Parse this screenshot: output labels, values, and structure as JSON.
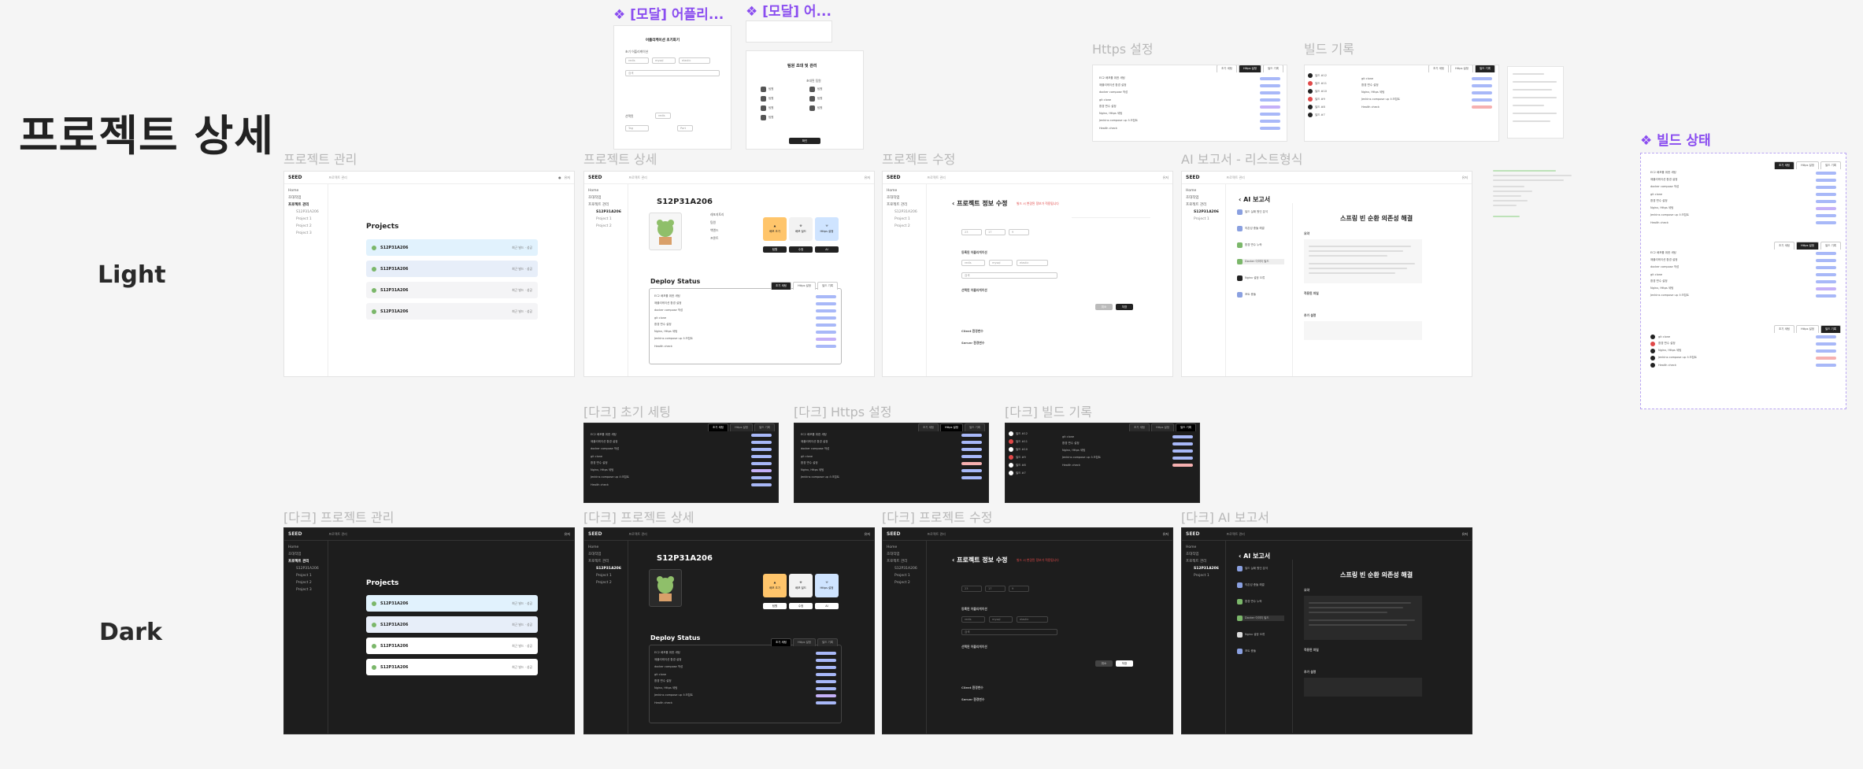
{
  "page": {
    "title": "프로젝트 상세"
  },
  "rows": {
    "light": "Light",
    "dark": "Dark"
  },
  "frame_labels": {
    "proj_manage": "프로젝트 관리",
    "proj_detail": "프로젝트 상세",
    "proj_edit": "프로젝트 수정",
    "ai_report_list": "AI 보고서 - 리스트형식",
    "https_setting": "Https 설정",
    "build_log": "빌드 기록",
    "dark_init": "[다크] 초기 세팅",
    "dark_https": "[다크] Https 설정",
    "dark_build": "[다크] 빌드 기록",
    "dark_proj_manage": "[다크] 프로젝트 관리",
    "dark_proj_detail": "[다크] 프로젝트 상세",
    "dark_proj_edit": "[다크] 프로젝트 수정",
    "dark_ai_report": "[다크] AI 보고서"
  },
  "component_labels": {
    "modal_app": "❖ [모달] 어플리...",
    "modal_2": "❖ [모달] 어...",
    "build_status": "❖ 빌드 상태"
  },
  "modal_app": {
    "title": "어플리케이션 초기화기",
    "label": "초기 어플리케이션"
  },
  "modal_invite": {
    "title": "팀원 초대 및 관리",
    "tab": "초대된 팀원",
    "button": "확인"
  },
  "app": {
    "logo": "SEED",
    "crumb": "프로젝트 관리",
    "user": "유저",
    "sidebar": [
      "Home",
      "초대작업",
      "프로젝트 관리",
      "S12P31A206",
      "Project 1",
      "Project 2",
      "Project 3"
    ]
  },
  "projects": {
    "heading": "Projects",
    "items": [
      {
        "name": "S12P31A206",
        "meta": "최근 빌드 · 성공"
      },
      {
        "name": "S12P31A206",
        "meta": "최근 빌드 · 성공"
      },
      {
        "name": "S12P31A206",
        "meta": "최근 빌드 · 성공"
      },
      {
        "name": "S12P31A206",
        "meta": "최근 빌드 · 성공"
      }
    ]
  },
  "detail": {
    "project_name": "S12P31A206",
    "deploy_status": "Deploy Status",
    "tiles": [
      "배포 초기",
      "배포 빌드",
      "Https 설정"
    ],
    "tabs": [
      "초기 세팅",
      "Https 설정",
      "빌드 기록"
    ],
    "steps": [
      "EC2 배포를 위한 세팅",
      "애플리케이션 환경 설정",
      "docker compose 작성",
      "git clone",
      "환경 변수 설정",
      "Nginx, Https 세팅",
      "Jenkins compose up 스크립트",
      "Health check"
    ]
  },
  "edit": {
    "title": "프로젝트 정보 수정",
    "warning": "빌드 시 변경된 정보가 적용됩니다",
    "section_app": "등록된 어플리케이션",
    "section_init": "선택된 어플리케이션",
    "client_label": "Client 환경변수",
    "server_label": "Server 환경변수",
    "cancel": "취소",
    "save": "저장"
  },
  "report": {
    "back": "AI 보고서",
    "title": "스프링 빈 순환 의존성 해결",
    "summary": "요약",
    "files": "적용된 파일",
    "extra": "추가 설명",
    "list_items": [
      "빌드 실패 원인 분석",
      "의존성 충돌 해결",
      "환경 변수 누락",
      "Docker 이미지 빌드",
      "Nginx 설정 오류",
      "포트 충돌"
    ]
  },
  "colors": {
    "accent_purple": "#8a4df0",
    "pill_blue": "#a8b8f8",
    "pill_red": "#f6b0b0",
    "tile_orange": "#ffc56b",
    "tile_blue": "#cfe4ff",
    "card_blue": "#e1f2fd"
  }
}
